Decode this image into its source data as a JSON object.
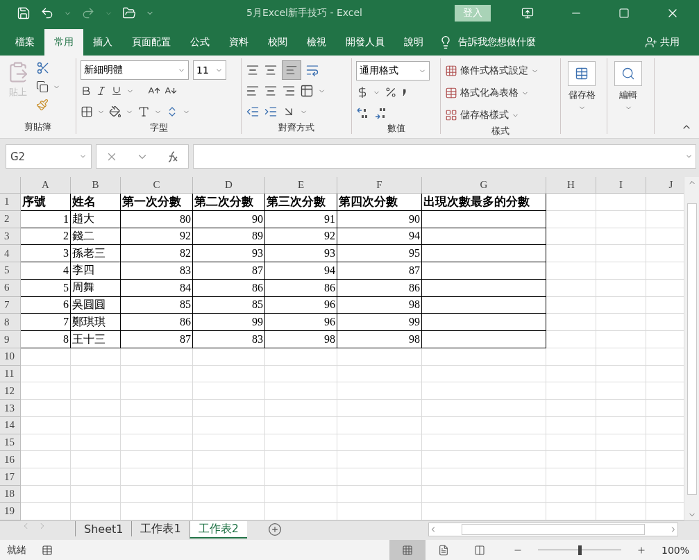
{
  "title_bar": {
    "title": "5月Excel新手技巧  -  Excel",
    "sign_in": "登入"
  },
  "ribbon_tabs": [
    {
      "label": "檔案",
      "selected": false
    },
    {
      "label": "常用",
      "selected": true
    },
    {
      "label": "插入",
      "selected": false
    },
    {
      "label": "頁面配置",
      "selected": false
    },
    {
      "label": "公式",
      "selected": false
    },
    {
      "label": "資料",
      "selected": false
    },
    {
      "label": "校閱",
      "selected": false
    },
    {
      "label": "檢視",
      "selected": false
    },
    {
      "label": "開發人員",
      "selected": false
    },
    {
      "label": "說明",
      "selected": false
    }
  ],
  "tell_me": "告訴我您想做什麼",
  "share": "共用",
  "ribbon": {
    "clipboard": {
      "paste": "貼上",
      "label": "剪貼簿"
    },
    "font": {
      "font_name": "新細明體",
      "font_size": "11",
      "label": "字型"
    },
    "alignment": {
      "label": "對齊方式"
    },
    "number": {
      "format": "通用格式",
      "label": "數值"
    },
    "styles": {
      "items": [
        "條件式格式設定",
        "格式化為表格",
        "儲存格樣式"
      ],
      "label": "樣式"
    },
    "cells": {
      "label": "儲存格"
    },
    "editing": {
      "label": "編輯"
    }
  },
  "formula_bar": {
    "name_box": "G2"
  },
  "sheet": {
    "columns": [
      "A",
      "B",
      "C",
      "D",
      "E",
      "F",
      "G",
      "H",
      "I",
      "J"
    ],
    "row_numbers": [
      "1",
      "2",
      "3",
      "4",
      "5",
      "6",
      "7",
      "8",
      "9",
      "10",
      "11",
      "12",
      "13",
      "14",
      "15",
      "16",
      "17",
      "18",
      "19"
    ],
    "rows": [
      [
        "序號",
        "姓名",
        "第一次分數",
        "第二次分數",
        "第三次分數",
        "第四次分數",
        "出現次數最多的分數"
      ],
      [
        "1",
        "趙大",
        "80",
        "90",
        "91",
        "90",
        ""
      ],
      [
        "2",
        "錢二",
        "92",
        "89",
        "92",
        "94",
        ""
      ],
      [
        "3",
        "孫老三",
        "82",
        "93",
        "93",
        "95",
        ""
      ],
      [
        "4",
        "李四",
        "83",
        "87",
        "94",
        "87",
        ""
      ],
      [
        "5",
        "周舞",
        "84",
        "86",
        "86",
        "86",
        ""
      ],
      [
        "6",
        "吳圓圓",
        "85",
        "85",
        "96",
        "98",
        ""
      ],
      [
        "7",
        "鄭琪琪",
        "86",
        "99",
        "96",
        "99",
        ""
      ],
      [
        "8",
        "王十三",
        "87",
        "83",
        "98",
        "98",
        ""
      ]
    ]
  },
  "sheet_tabs": [
    {
      "label": "Sheet1",
      "selected": false
    },
    {
      "label": "工作表1",
      "selected": false
    },
    {
      "label": "工作表2",
      "selected": true
    }
  ],
  "status_bar": {
    "mode": "就緒",
    "zoom_slider": {
      "level": 0.5
    },
    "zoom": "100%"
  }
}
